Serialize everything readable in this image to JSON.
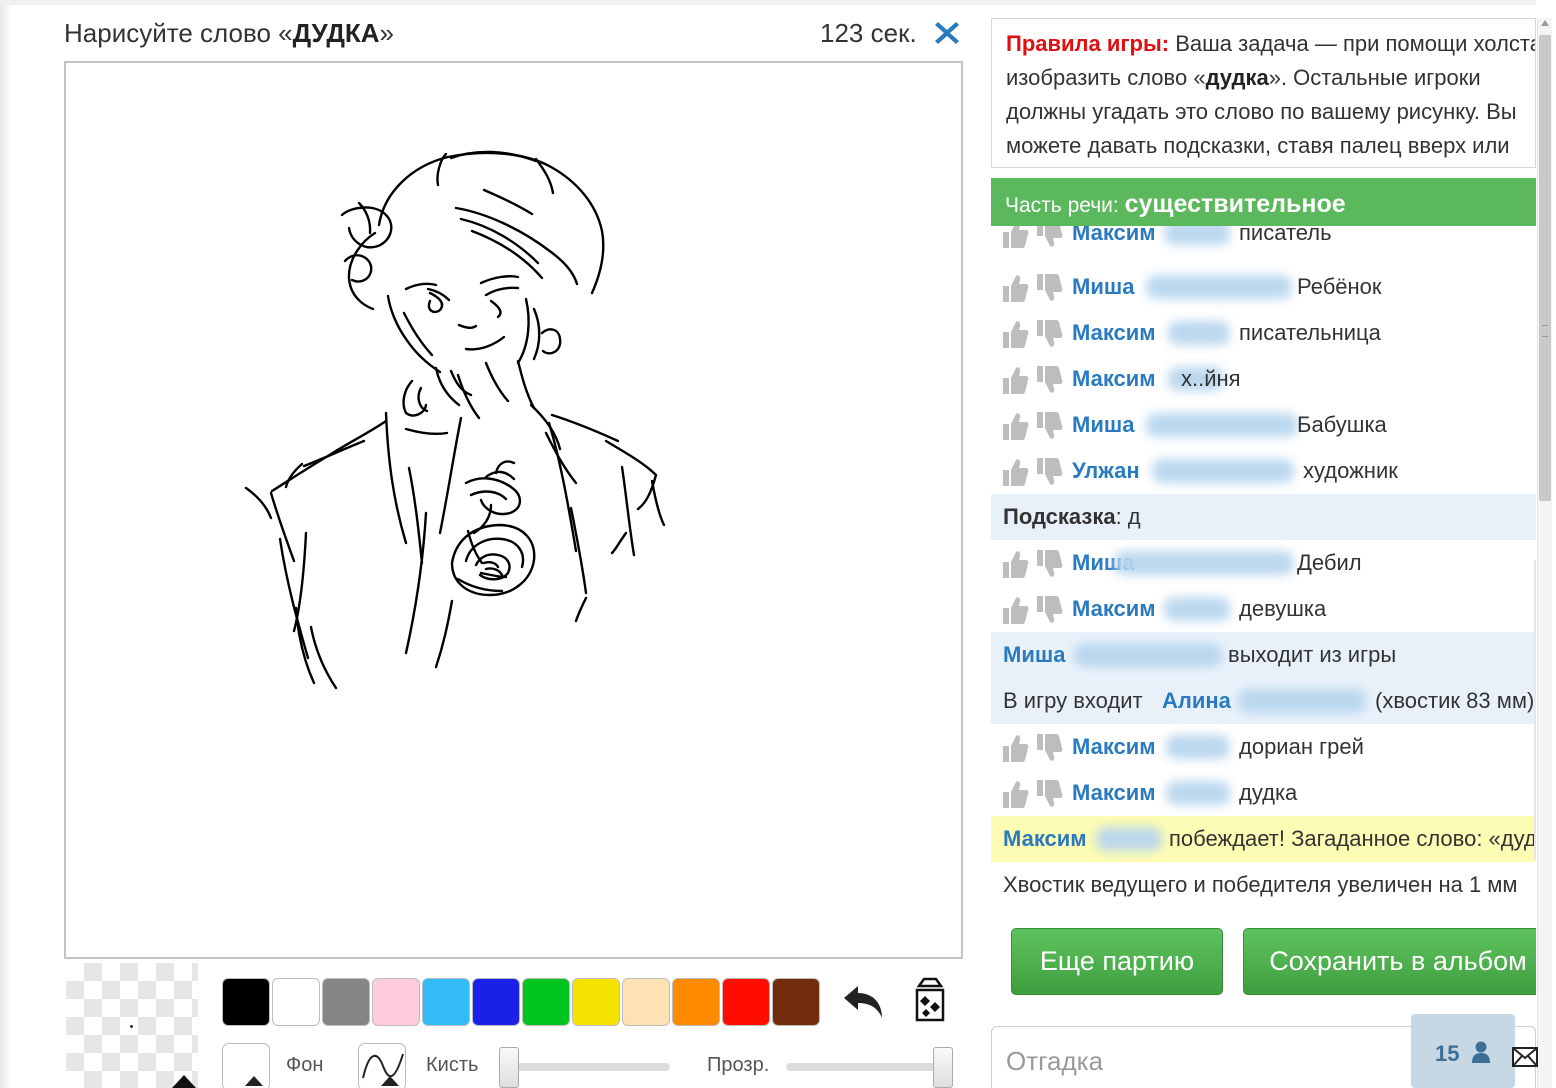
{
  "header": {
    "prompt_prefix": "Нарисуйте слово «",
    "word": "ДУДКА",
    "prompt_suffix": "»",
    "timer_value": "123",
    "timer_unit": "сек."
  },
  "palette": {
    "colors": [
      "#000000",
      "#ffffff",
      "#858585",
      "#ffccde",
      "#33bbf5",
      "#1a20e8",
      "#00c51f",
      "#f4e200",
      "#ffe2b4",
      "#ff8a00",
      "#ff0d00",
      "#702c0b"
    ]
  },
  "tools": {
    "background_label": "Фон",
    "brush_label": "Кисть",
    "opacity_label": "Прозр."
  },
  "rules": {
    "heading": "Правила игры:",
    "text_1": " Ваша задача — при помощи холста изобразить слово «",
    "word": "дудка",
    "text_2": "». Остальные игроки должны угадать это слово по вашему рисунку. Вы можете давать подсказки, ставя палец вверх или вниз."
  },
  "part_of_speech": {
    "label": "Часть речи:",
    "value": "существительное"
  },
  "chat": {
    "messages": [
      {
        "name": "Максим",
        "text": "писатель"
      },
      {
        "name": "Миша",
        "text": "Ребёнок"
      },
      {
        "name": "Максим",
        "text": "писательница"
      },
      {
        "name": "Максим",
        "text": "х..йня"
      },
      {
        "name": "Миша",
        "text": "Бабушка"
      },
      {
        "name": "Улжан",
        "text": "художник"
      },
      {
        "hint_label": "Подсказка",
        "hint_value": ": д"
      },
      {
        "name": "Миша",
        "text": "Дебил"
      },
      {
        "name": "Максим",
        "text": "девушка"
      },
      {
        "name": "Миша",
        "text": "выходит из игры"
      },
      {
        "prefix": "В игру входит ",
        "name": "Алина",
        "text": "(хвостик 83 мм)"
      },
      {
        "name": "Максим",
        "text": "дориан грей"
      },
      {
        "name": "Максим",
        "text": "дудка"
      },
      {
        "name": "Максим",
        "text": "побеждает! Загаданное слово: «дудка»"
      },
      {
        "text": "Хвостик ведущего и победителя увеличен на 1 мм"
      }
    ]
  },
  "buttons": {
    "new_game": "Еще партию",
    "save_album": "Сохранить в альбом"
  },
  "guess": {
    "placeholder": "Отгадка"
  },
  "online": {
    "count": "15"
  },
  "colors": {
    "accent_blue": "#2a7ac0",
    "success_green": "#5cb85c",
    "rules_red": "#e01010",
    "winner_yellow": "#fcfcb4"
  }
}
